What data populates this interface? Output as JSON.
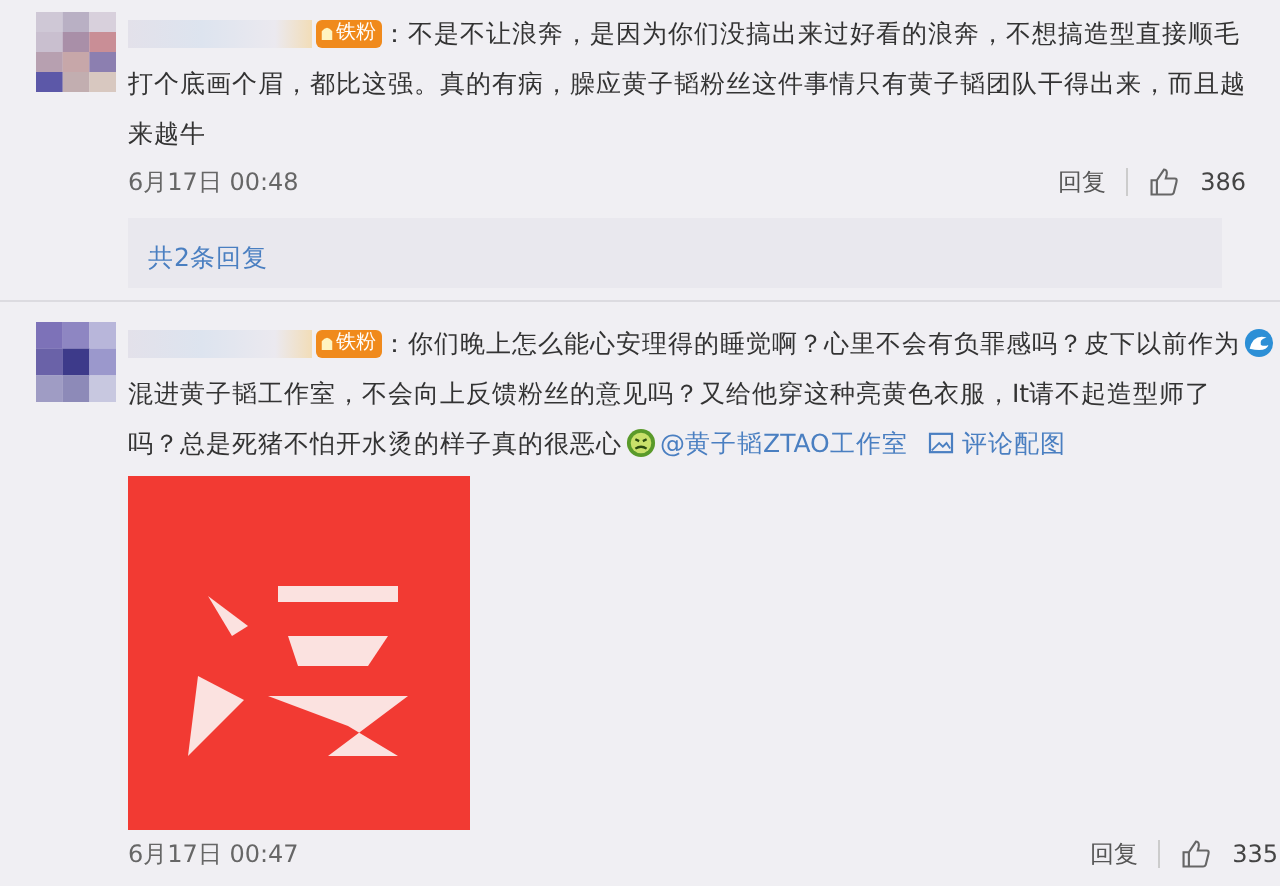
{
  "comments": [
    {
      "badge": "铁粉",
      "lines": [
        [
          {
            "kind": "text",
            "text": "：不是不让浪奔，是因为你们没搞出来过好看的浪奔，不想搞造型直接顺毛"
          }
        ],
        [
          {
            "kind": "text",
            "text": "打个底画个眉，都比这强。真的有病，臊应黄子韬粉丝这件事情只有黄子韬团队干得出来，而且越"
          }
        ],
        [
          {
            "kind": "text",
            "text": "来越牛"
          }
        ]
      ],
      "date": "6月17日 00:48",
      "reply": "回复",
      "likes": "386",
      "replies_link": "共2条回复"
    },
    {
      "badge": "铁粉",
      "lines": [
        [
          {
            "kind": "text",
            "text": "：你们晚上怎么能心安理得的睡觉啊？心里不会有负罪感吗？皮下以前作为"
          },
          {
            "kind": "wave"
          }
        ],
        [
          {
            "kind": "text",
            "text": "混进黄子韬工作室，不会向上反馈粉丝的意见吗？又给他穿这种亮黄色衣服，It请不起造型师了"
          }
        ],
        [
          {
            "kind": "text",
            "text": "吗？总是死猪不怕开水烫的样子真的很恶心"
          },
          {
            "kind": "face"
          },
          {
            "kind": "mention",
            "text": "@黄子韬ZTAO工作室"
          },
          {
            "kind": "attachment",
            "text": "评论配图"
          }
        ]
      ],
      "image": {
        "kind": "picture"
      },
      "date": "6月17日 00:47",
      "reply": "回复",
      "likes": "335"
    }
  ]
}
